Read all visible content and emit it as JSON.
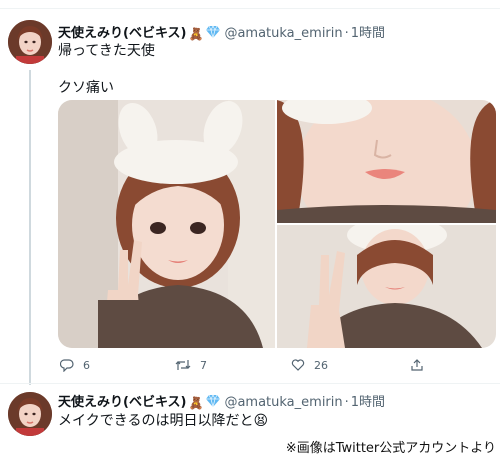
{
  "tweet": {
    "display_name": "天使えみり(ベビキス)",
    "badge_emoji": "🧸",
    "handle": "@amatuka_emirin",
    "separator": "·",
    "time": "1時間",
    "text_line1": "帰ってきた天使",
    "text_line2": "クソ痛い",
    "actions": {
      "reply_count": "6",
      "retweet_count": "7",
      "like_count": "26"
    }
  },
  "reply": {
    "display_name": "天使えみり(ベビキス)",
    "badge_emoji": "🧸",
    "handle": "@amatuka_emirin",
    "separator": "·",
    "time": "1時間",
    "text": "メイクできるのは明日以降だと",
    "emoji": "😫"
  },
  "credit": "※画像はTwitter公式アカウントより",
  "colors": {
    "text_primary": "#0f1419",
    "text_secondary": "#536471",
    "verified_blue": "#1d9bf0",
    "divider": "#eff3f4"
  },
  "icons": {
    "reply": "reply-icon",
    "retweet": "retweet-icon",
    "like": "heart-icon",
    "share": "share-icon",
    "verified": "verified-diamond-icon"
  }
}
